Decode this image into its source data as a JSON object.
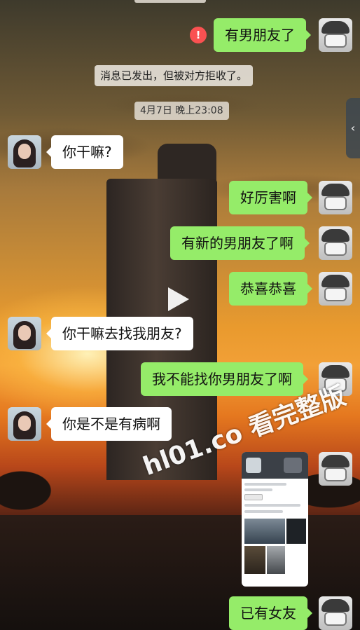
{
  "watermark": "hl01.co 看完整版",
  "system_notice": "消息已发出，但被对方拒收了。",
  "error_icon": "!",
  "timestamp": "4月7日 晚上23:08",
  "side_tab_icon": "‹",
  "messages": [
    {
      "from": "me",
      "text": "有男朋友了"
    },
    {
      "from": "her",
      "text": "你干嘛?"
    },
    {
      "from": "me",
      "text": "好厉害啊"
    },
    {
      "from": "me",
      "text": "有新的男朋友了啊"
    },
    {
      "from": "me",
      "text": "恭喜恭喜"
    },
    {
      "from": "her",
      "text": "你干嘛去找我朋友?"
    },
    {
      "from": "me",
      "text": "我不能找你男朋友了啊"
    },
    {
      "from": "her",
      "text": "你是不是有病啊"
    },
    {
      "from": "me",
      "text": "已有女友"
    }
  ],
  "colors": {
    "bubble_out": "#95ec69",
    "bubble_in": "#ffffff",
    "error": "#fa5151"
  },
  "icons": {
    "error": "exclamation-icon",
    "play": "play-icon",
    "side": "chevron-left-icon"
  }
}
